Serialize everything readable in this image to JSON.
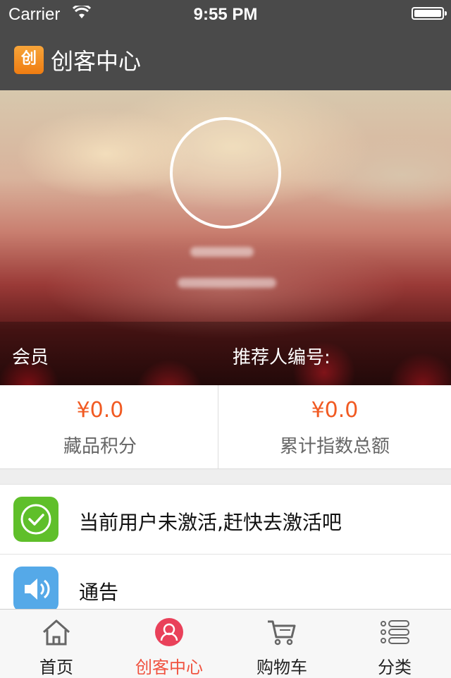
{
  "status_bar": {
    "carrier": "Carrier",
    "time": "9:55 PM"
  },
  "nav": {
    "title": "创客中心",
    "logo_text": "创"
  },
  "profile": {
    "member_label": "会员",
    "referrer_label": "推荐人编号:"
  },
  "stats": [
    {
      "value": "¥0.0",
      "label": "藏品积分"
    },
    {
      "value": "¥0.0",
      "label": "累计指数总额"
    }
  ],
  "list": [
    {
      "icon": "check-circle-icon",
      "text": "当前用户未激活,赶快去激活吧",
      "icon_color": "#5fbf2a"
    },
    {
      "icon": "speaker-icon",
      "text": "通告",
      "icon_color": "#55a9e8"
    }
  ],
  "tabs": [
    {
      "label": "首页",
      "icon": "home-icon",
      "active": false
    },
    {
      "label": "创客中心",
      "icon": "user-center-icon",
      "active": true
    },
    {
      "label": "购物车",
      "icon": "cart-icon",
      "active": false
    },
    {
      "label": "分类",
      "icon": "category-list-icon",
      "active": false
    }
  ],
  "colors": {
    "accent": "#f0523f",
    "price": "#f15a22",
    "bar": "#4a4a4a"
  }
}
